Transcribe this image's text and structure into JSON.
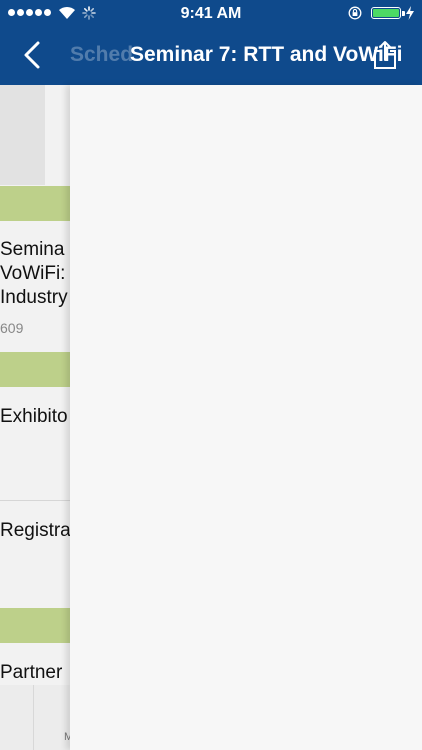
{
  "status": {
    "time": "9:41 AM"
  },
  "nav": {
    "back_title": "Sched",
    "title": "Seminar 7: RTT and VoWiFi"
  },
  "list": {
    "seminar_lines": [
      "Semina",
      "VoWiFi:",
      "Industry"
    ],
    "seminar_room": "609",
    "exhibitor": "Exhibito",
    "registration": "Registra",
    "partner": "Partner"
  },
  "tabs": {
    "m_label": "M"
  },
  "colors": {
    "nav_bg": "#0f4a8c",
    "section_green": "#bdd08a",
    "battery": "#4cd964"
  }
}
